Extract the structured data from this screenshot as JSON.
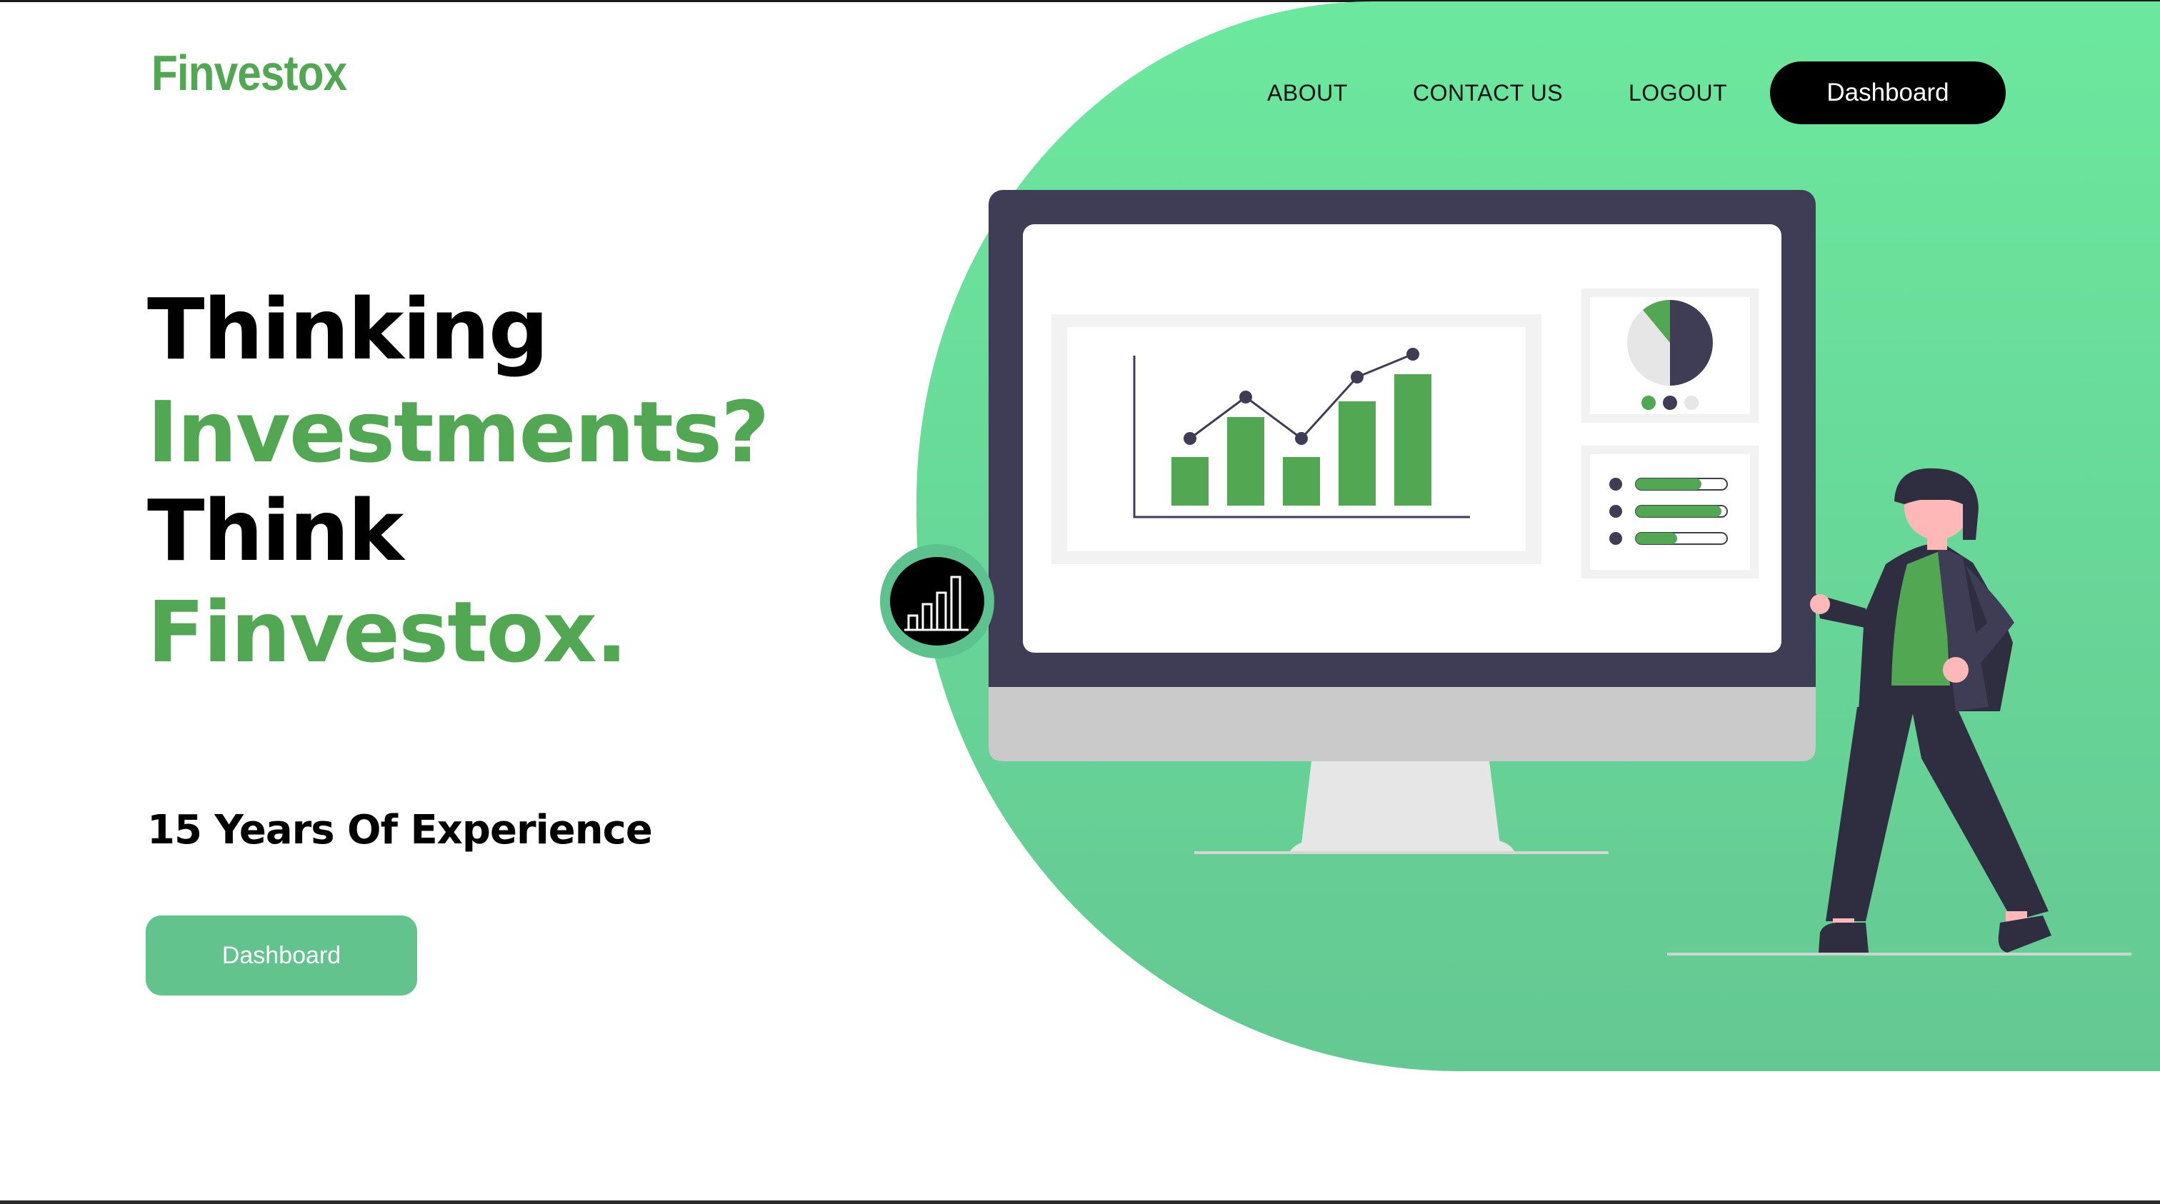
{
  "brand": {
    "name": "Finvestox"
  },
  "nav": {
    "about": "ABOUT",
    "contact": "CONTACT US",
    "logout": "LOGOUT",
    "dashboard": "Dashboard"
  },
  "hero": {
    "line1": "Thinking",
    "line2": "Investments?",
    "line3": "Think",
    "line4": "Finvestox.",
    "experience": "15 Years Of Experience",
    "cta": "Dashboard"
  },
  "colors": {
    "brand_green": "#52a852",
    "blob_green": "#6ce89e",
    "cta_green": "#62c48c",
    "dark": "#3f3d56"
  },
  "illustration": {
    "name": "analytics-monitor-illustration",
    "icon": "bar-chart-icon"
  }
}
